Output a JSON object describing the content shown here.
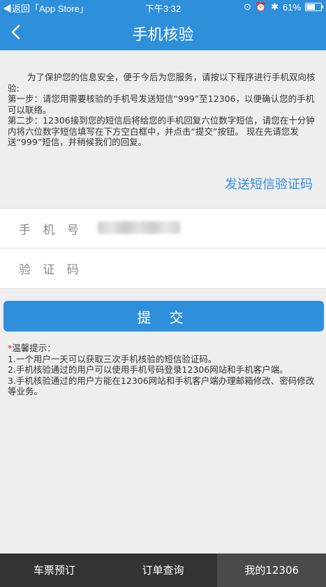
{
  "status_bar": {
    "back_app": "◀返回「App Store」",
    "time": "下午3:32",
    "battery": "61%",
    "battery_level": 0.61
  },
  "nav": {
    "title": "手机核验",
    "back_icon": "chevron-left-icon"
  },
  "intro": {
    "paragraph": "为了保护您的信息安全，便于今后为您服务，请按以下程序进行手机双向核验:",
    "step1": "第一步：请您用需要核验的手机号发送短信“999”至12306，以便确认您的手机可以联络。",
    "step2": "第二步：12306接到您的短信后将给您的手机回复六位数字短信，请您在十分钟内将六位数字短信填写在下方空白框中，并点击“提交”按钮。 现在先请您发送“999”短信，并稍候我们的回复。"
  },
  "send_sms_link": "发送短信验证码",
  "form": {
    "phone_label": "手 机 号",
    "code_label": "验 证 码",
    "code_value": "",
    "code_placeholder": ""
  },
  "submit_label": "提 交",
  "tips": {
    "title": "温馨提示：",
    "items": [
      "1.一个用户一天可以获取三次手机核验的短信验证码。",
      "2.手机核验通过的用户可以使用手机号码登录12306网站和手机客户端。",
      "3.手机核验通过的用户方能在12306网站和手机客户端办理邮箱修改、密码修改等业务。"
    ]
  },
  "tabbar": {
    "items": [
      {
        "label": "车票预订"
      },
      {
        "label": "订单查询"
      },
      {
        "label": "我的12306"
      }
    ]
  },
  "colors": {
    "accent": "#2e8fdb",
    "tabbar_bg": "#333333"
  }
}
